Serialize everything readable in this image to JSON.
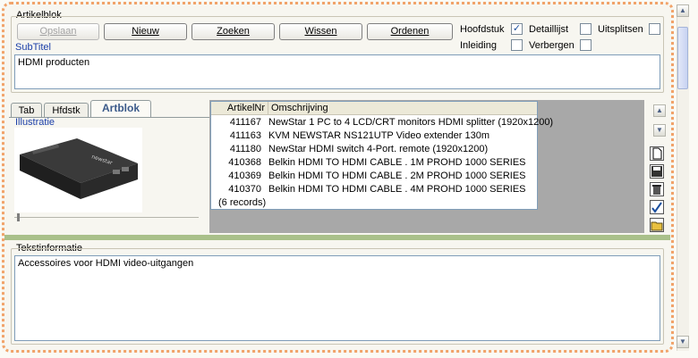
{
  "artikelblok_group": {
    "label": "Artikelblok"
  },
  "toolbar": {
    "save_label": "Opslaan",
    "new_label": "Nieuw",
    "search_label": "Zoeken",
    "clear_label": "Wissen",
    "sort_label": "Ordenen"
  },
  "options": {
    "hoofdstuk": {
      "label": "Hoofdstuk",
      "checked": true
    },
    "detaillijst": {
      "label": "Detaillijst",
      "checked": false
    },
    "uitsplitsen": {
      "label": "Uitsplitsen",
      "checked": false
    },
    "inleiding": {
      "label": "Inleiding",
      "checked": false
    },
    "verbergen": {
      "label": "Verbergen",
      "checked": false
    },
    "check_mark": "✓"
  },
  "subtitle": {
    "label": "SubTitel",
    "value": "HDMI producten"
  },
  "tabs": [
    {
      "label": "Tab"
    },
    {
      "label": "Hfdstk"
    },
    {
      "label": "Artblok"
    }
  ],
  "illustration": {
    "label": "Illustratie"
  },
  "grid": {
    "columns": [
      "ArtikelNr",
      "Omschrijving"
    ],
    "rows": [
      {
        "nr": "411167",
        "desc": "NewStar 1 PC to 4 LCD/CRT monitors HDMI splitter (1920x1200)"
      },
      {
        "nr": "411163",
        "desc": "KVM NEWSTAR NS121UTP Video extender 130m"
      },
      {
        "nr": "411180",
        "desc": "NewStar HDMI switch 4-Port. remote (1920x1200)"
      },
      {
        "nr": "410368",
        "desc": "Belkin HDMI TO HDMI CABLE . 1M PROHD 1000 SERIES"
      },
      {
        "nr": "410369",
        "desc": "Belkin HDMI TO HDMI CABLE . 2M PROHD 1000 SERIES"
      },
      {
        "nr": "410370",
        "desc": "Belkin HDMI TO HDMI CABLE . 4M PROHD 1000 SERIES"
      }
    ],
    "footer": "(6 records)"
  },
  "tekstinformatie": {
    "label": "Tekstinformatie",
    "value": "Accessoires voor HDMI video-uitgangen"
  },
  "colors": {
    "frame": "#f1a36a",
    "divider": "#a9c08a",
    "grid_bg": "#a8a8a8",
    "label_blue": "#1a3ea8"
  }
}
